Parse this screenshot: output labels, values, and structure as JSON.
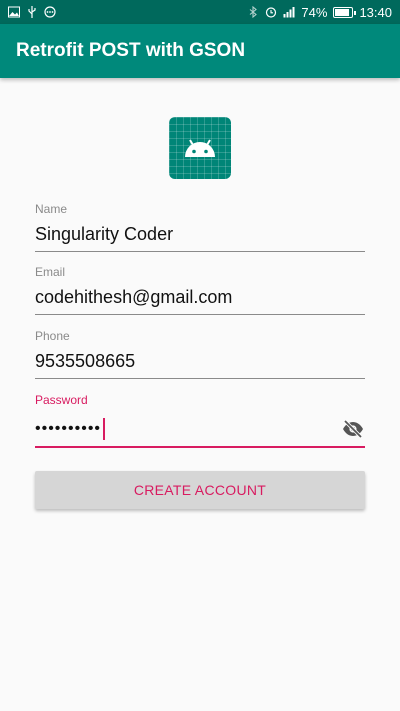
{
  "statusbar": {
    "battery": "74%",
    "time": "13:40"
  },
  "appbar": {
    "title": "Retrofit POST with GSON"
  },
  "logo": {
    "icon": "android-icon",
    "color": "#008577"
  },
  "form": {
    "name": {
      "label": "Name",
      "value": "Singularity Coder"
    },
    "email": {
      "label": "Email",
      "value": "codehithesh@gmail.com"
    },
    "phone": {
      "label": "Phone",
      "value": "9535508665"
    },
    "password": {
      "label": "Password",
      "masked": "••••••••••",
      "toggle_icon": "visibility-off-icon"
    }
  },
  "button": {
    "label": "CREATE ACCOUNT"
  },
  "colors": {
    "primary": "#00897b",
    "primary_dark": "#00695c",
    "accent": "#d81b60"
  }
}
